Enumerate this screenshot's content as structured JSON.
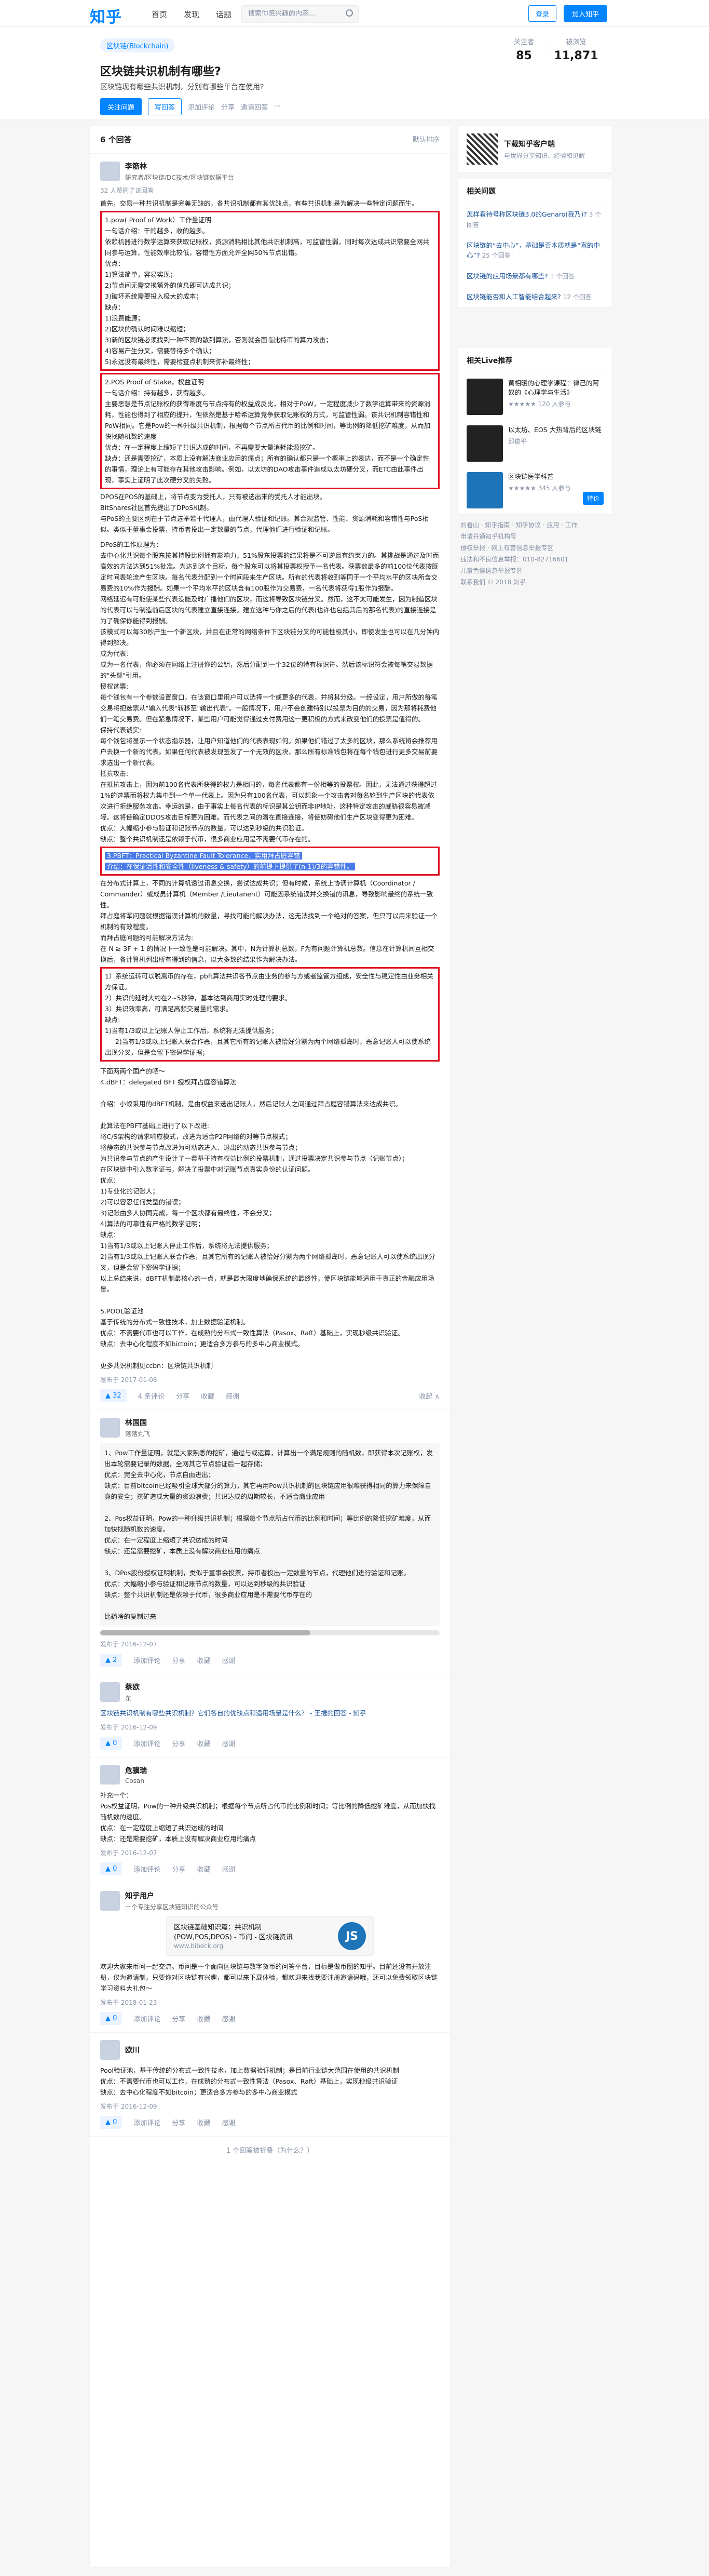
{
  "nav": {
    "logo": "知乎",
    "links": [
      "首页",
      "发现",
      "话题"
    ],
    "search_placeholder": "搜索你感兴趣的内容...",
    "login": "登录",
    "join": "加入知乎"
  },
  "question": {
    "tag": "区块链(Blockchain)",
    "title": "区块链共识机制有哪些?",
    "desc": "区块链现有哪些共识机制，分别有哪些平台在使用?",
    "follow_btn": "关注问题",
    "write_btn": "写回答",
    "actions": [
      "添加评论",
      "分享",
      "邀请回答",
      "···"
    ],
    "followers_label": "关注者",
    "followers": "85",
    "views_label": "被浏览",
    "views": "11,871"
  },
  "answers_header": {
    "count": "6 个回答",
    "sort": "默认排序"
  },
  "answers": [
    {
      "name": "李筋林",
      "bio": "研究者/区块链/DC技术/区块链数据平台",
      "agree": "32 人赞同了该回答",
      "intro": "首先，交易一种共识机制是完美无缺的，各共识机制都有其优缺点，有些共识机制是为解决一些特定问题而生。",
      "box1": "1.pow( Proof of Work）工作量证明\n一句话介绍：干的越多，收的越多。\n依赖机器进行数学运算来获取记账权，资源消耗相比其他共识机制高，可监管性弱，同时每次达成共识需要全网共同参与运算，性能效率比较低，容错性方面允许全网50%节点出错。\n优点：\n1)算法简单，容易实现；\n2)节点间无需交换额外的信息即可达成共识；\n3)破坏系统需要投入极大的成本；\n缺点：\n1)浪费能源；\n2)区块的确认时间难以缩短；\n3)新的区块链必须找到一种不同的散列算法，否则就会面临比特币的算力攻击；\n4)容易产生分叉，需要等待多个确认；\n5)永远没有最终性，需要检查点机制来弥补最终性；",
      "box2": "2.POS Proof of Stake，权益证明\n一句话介绍：持有越多，获得越多。\n主要思想是节点记账权的获得难度与节点持有的权益成反比，相对于PoW，一定程度减少了数学运算带来的资源消耗，性能也得到了相应的提升，但依然是基于哈希运算竞争获取记账权的方式，可监管性弱。该共识机制容错性和PoW相同。它是Pow的一种升级共识机制，根据每个节点所占代币的比例和时间，等比例的降低挖矿难度，从而加快找随机数的速度\n优点：在一定程度上缩短了共识达成的时间，不再需要大量消耗能源挖矿。\n缺点：还是需要挖矿，本质上没有解决商业应用的痛点；所有的确认都只是一个概率上的表达，而不是一个确定性的事情，理论上有可能存在其他攻击影响。例如，以太坊的DAO攻击事件造成以太坊硬分叉，而ETC由此事件出现，事实上证明了此次硬分叉的失败。",
      "p1": "DPOS在POS的基础上，将节点变为受托人，只有被选出来的受托人才能出块。\nBitShares社区首先提出了DPoS机制。\n与PoS的主要区别在于节点选举若干代理人，由代理人验证和记账。其合规监管、性能、资源消耗和容错性与PoS相似。类似于董事会投票，持币者投出一定数量的节点，代理他们进行验证和记账。",
      "p2": "DPoS的工作原理为：\n去中心化共识每个股东按其持股比例拥有影响力，51%股东投票的结果将是不可逆且有约束力的。其挑战是通过及时而高效的方法达到51%批准。为达到这个目标，每个股东可以将其投票权授予一名代表。获票数最多的前100位代表按既定时间表轮流产生区块。每名代表分配到一个时间段来生产区块。所有的代表将收到等同于一个平均水平的区块所含交易费的10%作为报酬。如果一个平均水平的区块含有100股作为交易费，一名代表将获得1股作为报酬。\n网络延迟有可能使某些代表没能及时广播他们的区块，而这将导致区块链分叉。然而，这不太可能发生，因为制造区块的代表可以与制造前后区块的代表建立直接连接。建立这种与你之后的代表(也许也包括其后的那名代表)的直接连接是为了确保你能得到报酬。\n该模式可以每30秒产生一个新区块，并且在正常的网络条件下区块链分叉的可能性极其小，即使发生也可以在几分钟内得到解决。\n成为代表:\n成为一名代表，你必须在网络上注册你的公钥，然后分配到一个32位的特有标识符。然后该标识符会被每笔交易数据的\"头部\"引用。\n授权选票:\n每个钱包有一个参数设置窗口，在该窗口里用户可以选择一个或更多的代表，并将其分级。一经设定，用户所做的每笔交易将把选票从\"输入代表\"转移至\"输出代表\"。一般情况下，用户不会创建特别以投票为目的的交易，因为那将耗费他们一笔交易费。但在紧急情况下，某些用户可能觉得通过支付费用这一更积极的方式来改变他们的投票是值得的。\n保持代表诚实:\n每个钱包将显示一个状态指示器，让用户知道他们的代表表现如何。如果他们错过了太多的区块，那么系统将会推荐用户去换一个新的代表。如果任何代表被发现签发了一个无效的区块，那么所有标准钱包将在每个钱包进行更多交易前要求选出一个新代表。\n抵抗攻击:\n在抵抗攻击上，因为前100名代表所获得的权力是相同的，每名代表都有一份相等的投票权。因此，无法通过获得超过1%的选票而将权力集中到一个单一代表上。因为只有100名代表，可以想象一个攻击者对每名轮到生产区块的代表依次进行拒绝服务攻击。幸运的是，由于事实上每名代表的标识是其公钥而非IP地址，这种特定攻击的威胁很容易被减轻。这将使确定DDOS攻击目标更为困难。而代表之间的潜在直接连接，将使妨碍他们生产区块变得更为困难。\n优点：大幅缩小参与验证和记账节点的数量，可以达到秒级的共识验证。\n缺点：整个共识机制还是依赖于代币，很多商业应用是不需要代币存在的。",
      "hl_bar": "3.PBFT：Practical Byzantine Fault Tolerance，实用拜占庭容错",
      "hl_bar2": "介绍：在保证活性和安全性（liveness & safety）的前提下提供了(n-1)/3的容错性。",
      "p3": "在分布式计算上，不同的计算机透过讯息交换，尝试达成共识；但有时候，系统上协调计算机（Coordinator / Commander）或成员计算机（Member /Lieutanent）可能因系统错误并交换错的讯息，导致影响最终的系统一致性。\n拜占庭将军问题就根据错误计算机的数量，寻找可能的解决办法，这无法找到一个绝对的答案，但只可以用来验证一个机制的有效程度。\n而拜占庭问题的可能解决方法为:\n在 N ≥ 3F + 1 的情况下一致性是可能解决。其中，N为计算机总数，F为有问题计算机总数。信息在计算机间互相交换后，各计算机列出所有得到的信息，以大多数的结果作为解决办法。",
      "box3": "1）系统运转可以脱离币的存在，pbft算法共识各节点由业务的参与方或者监管方组成，安全性与稳定性由业务相关方保证。\n2）共识的延时大约在2~5秒钟，基本达到商用实时处理的要求。\n3）共识效率高，可满足高频交易量的需求。\n缺点:\n1)当有1/3或以上记账人停止工作后，系统将无法提供服务；\n     2)当有1/3或以上记账人联合作恶，且其它所有的记账人被恰好分割为两个网络孤岛时，恶意记账人可以使系统出现分叉，但是会留下密码学证据；",
      "p4": "下面两两个国产的吧～\n4.dBFT：delegated BFT 授权拜占庭容错算法\n\n介绍：小蚁采用的dBFT机制，是由权益来选出记账人，然后记账人之间通过拜占庭容错算法来达成共识。\n\n此算法在PBFT基础上进行了以下改进:\n将C/S架构的请求响应模式，改进为适合P2P网络的对等节点模式；\n将静态的共识参与节点改进为可动态进入、退出的动态共识参与节点；\n为共识参与节点的产生设计了一套基于持有权益比例的投票机制，通过投票决定共识参与节点（记账节点）；\n在区块链中引入数字证书，解决了投票中对记账节点真实身份的认证问题。\n优点：\n1)专业化的记账人；\n2)可以容忍任何类型的错误；\n3)记账由多人协同完成，每一个区块都有最终性，不会分叉；\n4)算法的可靠性有严格的数学证明；\n缺点：\n1)当有1/3或以上记账人停止工作后，系统将无法提供服务；\n2)当有1/3或以上记账人联合作恶，且其它所有的记账人被恰好分割为两个网络孤岛时，恶意记账人可以使系统出现分叉，但是会留下密码学证据；\n以上总结来说，dBFT机制最核心的一点，就是最大限度地确保系统的最终性，使区块链能够适用于真正的金融应用场景。\n\n5.POOL验证池\n基于传统的分布式一致性技术，加上数据验证机制。\n优点：不需要代币也可以工作，在成熟的分布式一致性算法（Pasox、Raft）基础上，实现秒级共识验证。\n缺点：去中心化程度不如bictoin；更适合多方参与的多中心商业模式。\n\n更多共识机制见ccbn：区块链共识机制",
      "time": "发布于 2017-01-08",
      "vote": "▲ 32",
      "actions": [
        "4 条评论",
        "分享",
        "收藏",
        "感谢",
        "收起 ∧"
      ]
    },
    {
      "name": "林国国",
      "bio": "落落丸飞",
      "p": "1、Pow工作量证明，就是大家熟悉的挖矿，通过与或运算，计算出一个满足规则的随机数，即获得本次记账权，发出本轮需要记录的数据，全网其它节点验证后一起存储；\n优点：完全去中心化，节点自由进出；\n缺点：目前bitcoin已经吸引全球大部分的算力，其它再用Pow共识机制的区块链应用很难获得相同的算力来保障自身的安全；挖矿造成大量的资源浪费；共识达成的周期较长，不适合商业应用\n\n2、Pos权益证明，Pow的一种升级共识机制；根据每个节点所占代币的比例和时间；等比例的降低挖矿难度，从而加快找随机数的速度。\n优点：在一定程度上缩短了共识达成的时间\n缺点：还是需要挖矿，本质上没有解决商业应用的痛点\n\n3、DPos股份授权证明机制，类似于董事会投票，持币者投出一定数量的节点，代理他们进行验证和记账。\n优点：大幅缩小参与验证和记账节点的数量，可以达到秒级的共识验证\n缺点：整个共识机制还是依赖于代币，很多商业应用是不需要代币存在的\n\n比药啥的复制过来",
      "time": "发布于 2016-12-07",
      "vote": "▲ 2",
      "actions": [
        "添加评论",
        "分享",
        "收藏",
        "感谢"
      ]
    },
    {
      "name": "蔡欧",
      "bio": "东",
      "p": "区块链共识机制有哪些共识机制？它们各自的优缺点和适用场景是什么？ - 王捷的回答 - 知乎",
      "time": "发布于 2016-12-09",
      "vote": "▲ 0",
      "actions": [
        "添加评论",
        "分享",
        "收藏",
        "感谢"
      ]
    },
    {
      "name": "危骥瑞",
      "bio": "Cosan",
      "p": "补充一个：\nPos权益证明，Pow的一种升级共识机制；根据每个节点所占代币的比例和时间；等比例的降低挖矿难度，从而加快找随机数的速度。\n优点：在一定程度上缩短了共识达成的时间\n缺点：还是需要挖矿，本质上没有解决商业应用的痛点",
      "time": "发布于 2016-12-07",
      "vote": "▲ 0",
      "actions": [
        "添加评论",
        "分享",
        "收藏",
        "感谢"
      ]
    },
    {
      "name": "知乎用户",
      "bio": "一个专注分享区块链知识的公众号",
      "card_title": "区块链基础知识篇：共识机制\n(POW,POS,DPOS) - 币问 - 区块链资讯",
      "card_url": "www.bibeck.org",
      "card_logo": "JS",
      "p": "欢迎大家来币问一起交流。币问是一个面向区块链与数字货币的问答平台，目标是做币圈的知乎。目前还没有开放注册，仅为邀请制，只要你对区块链有兴趣，都可以来下载体验，都欢迎来找我要注册邀请码哦，还可以免费领取区块链学习资料大礼包～",
      "time": "发布于 2018-01-23",
      "vote": "▲ 0",
      "actions": [
        "添加评论",
        "分享",
        "收藏",
        "感谢"
      ]
    },
    {
      "name": "欧川",
      "bio": "",
      "p": "Pool验证池，基于传统的分布式一致性技术，加上数据验证机制；是目前行业链大范围在使用的共识机制\n优点：不需要代币也可以工作，在成熟的分布式一致性算法（Pasox、Raft）基础上，实现秒级共识验证\n缺点：去中心化程度不如bitcoin；更适合多方参与的多中心商业模式",
      "time": "发布于 2016-12-09",
      "vote": "▲ 0",
      "actions": [
        "添加评论",
        "分享",
        "收藏",
        "感谢"
      ]
    }
  ],
  "collapsed": "1 个回答被折叠（为什么？）",
  "sidebar": {
    "download_title": "下载知乎客户端",
    "download_sub": "与世界分享知识、经验和见解",
    "related_title": "相关问题",
    "related": [
      {
        "q": "怎样看待号称区块链3.0的Genaro(我乃)?",
        "c": "3 个回答"
      },
      {
        "q": "区块链的“去中心”，基础是否本质就是“寡的中心”?",
        "c": "25 个回答"
      },
      {
        "q": "区块链的应用场景都有哪些?",
        "c": "1 个回答"
      },
      {
        "q": "区块链能否和人工智能结合起来?",
        "c": "12 个回答"
      }
    ],
    "live_title": "相关Live推荐",
    "lives": [
      {
        "t": "黄相暖的心理学课程：律己的阿奴的《心理学与生活》",
        "s": "★★★★★ 120 人参与"
      },
      {
        "t": "以太坊、EOS 大热背后的区块链",
        "s": "邱俊平"
      },
      {
        "t": "区块链医学科普",
        "s": "★★★★★ 345 人参与",
        "btn": "特价"
      }
    ],
    "footer": "刘看山 · 知乎指南 · 知乎协议 · 应用 · 工作\n申请开通知乎机构号\n侵权举报 · 网上有害信息举报专区\n违法和不良信息举报：010-82716601\n儿童色情信息举报专区\n联系我们 © 2018 知乎"
  },
  "colors": {
    "brand": "#0084ff",
    "highlight_border": "#e01020",
    "highlight_bar": "#4a7be8"
  }
}
